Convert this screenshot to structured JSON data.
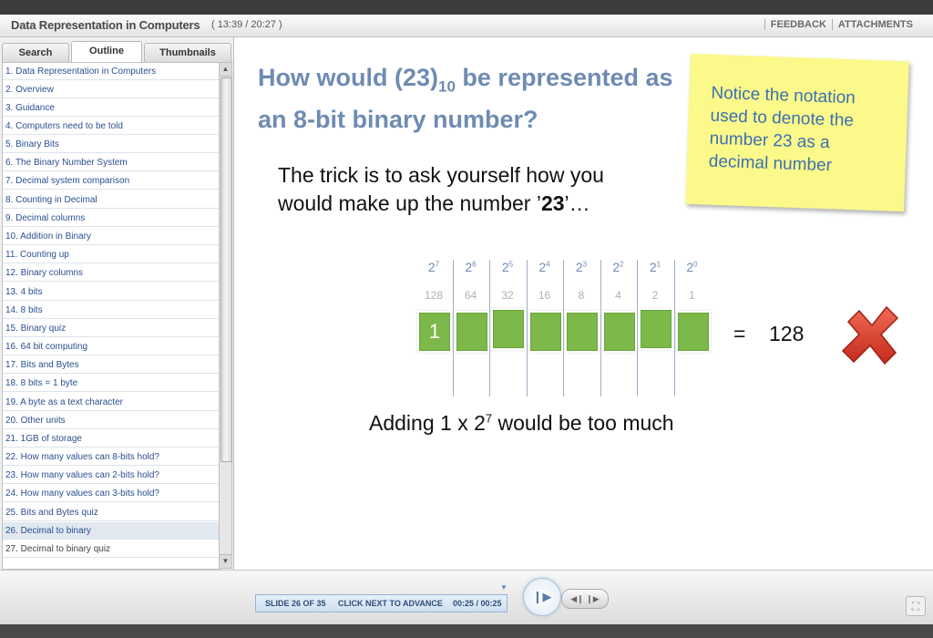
{
  "header": {
    "course_title": "Data Representation in Computers",
    "elapsed": "( 13:39 / 20:27 )",
    "feedback": "FEEDBACK",
    "attachments": "ATTACHMENTS"
  },
  "sidebar": {
    "tabs": [
      "Search",
      "Outline",
      "Thumbnails"
    ],
    "active_tab": "Outline",
    "items": [
      "1. Data Representation in Computers",
      "2. Overview",
      "3. Guidance",
      "4. Computers need to be told",
      "5. Binary Bits",
      "6. The Binary Number System",
      "7. Decimal system comparison",
      "8. Counting in Decimal",
      "9. Decimal columns",
      "10. Addition in Binary",
      "11. Counting up",
      "12. Binary columns",
      "13. 4 bits",
      "14. 8 bits",
      "15. Binary quiz",
      "16. 64 bit computing",
      "17. Bits and Bytes",
      "18. 8 bits = 1 byte",
      "19. A byte as a text character",
      "20. Other units",
      "21. 1GB of storage",
      "22. How many values can 8-bits hold?",
      "23. How many values can 2-bits hold?",
      "24. How many values can 3-bits hold?",
      "25. Bits and Bytes quiz",
      "26. Decimal to binary",
      "27. Decimal to binary quiz"
    ],
    "selected_index": 25
  },
  "slide": {
    "title_a": "How would (23)",
    "title_sub": "10",
    "title_b": " be represented as an 8-bit binary number?",
    "sticky_note": "Notice the notation used to denote the number 23 as a decimal number",
    "trick_a": "The trick is to ask yourself how you would make up the number ’",
    "trick_bold": "23",
    "trick_b": "’…",
    "powers": [
      {
        "base": "2",
        "exp": "7",
        "value": "128",
        "box": "1"
      },
      {
        "base": "2",
        "exp": "6",
        "value": "64",
        "box": ""
      },
      {
        "base": "2",
        "exp": "5",
        "value": "32",
        "box": ""
      },
      {
        "base": "2",
        "exp": "4",
        "value": "16",
        "box": ""
      },
      {
        "base": "2",
        "exp": "3",
        "value": "8",
        "box": ""
      },
      {
        "base": "2",
        "exp": "2",
        "value": "4",
        "box": ""
      },
      {
        "base": "2",
        "exp": "1",
        "value": "2",
        "box": ""
      },
      {
        "base": "2",
        "exp": "0",
        "value": "1",
        "box": ""
      }
    ],
    "equals": "=",
    "result": "128",
    "adding_a": "Adding 1 x 2",
    "adding_exp": "7",
    "adding_b": " would be too much",
    "cross_color": "#d63a2a"
  },
  "player": {
    "slide_counter": "SLIDE 26 OF 35",
    "instruction": "CLICK NEXT TO ADVANCE",
    "time": "00:25 / 00:25",
    "progress": 1.0
  },
  "colors": {
    "title": "#6e8bb3",
    "box_green": "#7db84a",
    "sticky_yellow": "#fbf98a",
    "link_blue": "#2a4f8f"
  }
}
